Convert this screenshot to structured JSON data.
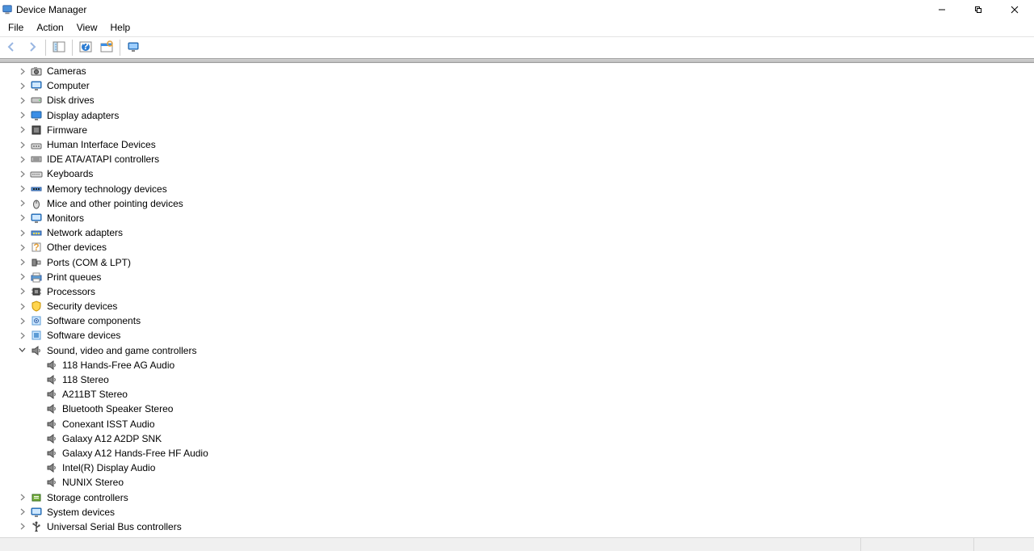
{
  "window": {
    "title": "Device Manager"
  },
  "menu": {
    "items": [
      "File",
      "Action",
      "View",
      "Help"
    ]
  },
  "toolbar": {
    "back": "back-icon",
    "forward": "forward-icon",
    "up_tree": "show-hide-tree-icon",
    "help": "help-icon",
    "scan": "scan-icon",
    "monitor": "monitor-icon"
  },
  "tree": [
    {
      "label": "Cameras",
      "icon": "camera",
      "expanded": false,
      "depth": 1
    },
    {
      "label": "Computer",
      "icon": "computer",
      "expanded": false,
      "depth": 1
    },
    {
      "label": "Disk drives",
      "icon": "disk",
      "expanded": false,
      "depth": 1
    },
    {
      "label": "Display adapters",
      "icon": "display",
      "expanded": false,
      "depth": 1
    },
    {
      "label": "Firmware",
      "icon": "firmware",
      "expanded": false,
      "depth": 1
    },
    {
      "label": "Human Interface Devices",
      "icon": "hid",
      "expanded": false,
      "depth": 1
    },
    {
      "label": "IDE ATA/ATAPI controllers",
      "icon": "ide",
      "expanded": false,
      "depth": 1
    },
    {
      "label": "Keyboards",
      "icon": "keyboard",
      "expanded": false,
      "depth": 1
    },
    {
      "label": "Memory technology devices",
      "icon": "memory",
      "expanded": false,
      "depth": 1
    },
    {
      "label": "Mice and other pointing devices",
      "icon": "mouse",
      "expanded": false,
      "depth": 1
    },
    {
      "label": "Monitors",
      "icon": "monitor",
      "expanded": false,
      "depth": 1
    },
    {
      "label": "Network adapters",
      "icon": "network",
      "expanded": false,
      "depth": 1
    },
    {
      "label": "Other devices",
      "icon": "other",
      "expanded": false,
      "depth": 1
    },
    {
      "label": "Ports (COM & LPT)",
      "icon": "ports",
      "expanded": false,
      "depth": 1
    },
    {
      "label": "Print queues",
      "icon": "printer",
      "expanded": false,
      "depth": 1
    },
    {
      "label": "Processors",
      "icon": "cpu",
      "expanded": false,
      "depth": 1
    },
    {
      "label": "Security devices",
      "icon": "security",
      "expanded": false,
      "depth": 1
    },
    {
      "label": "Software components",
      "icon": "swcomp",
      "expanded": false,
      "depth": 1
    },
    {
      "label": "Software devices",
      "icon": "swdev",
      "expanded": false,
      "depth": 1
    },
    {
      "label": "Sound, video and game controllers",
      "icon": "sound",
      "expanded": true,
      "depth": 1,
      "children": [
        {
          "label": "118 Hands-Free AG Audio",
          "icon": "speaker"
        },
        {
          "label": "118 Stereo",
          "icon": "speaker"
        },
        {
          "label": "A211BT Stereo",
          "icon": "speaker"
        },
        {
          "label": "Bluetooth Speaker Stereo",
          "icon": "speaker"
        },
        {
          "label": "Conexant ISST Audio",
          "icon": "speaker"
        },
        {
          "label": "Galaxy A12 A2DP SNK",
          "icon": "speaker"
        },
        {
          "label": "Galaxy A12 Hands-Free HF Audio",
          "icon": "speaker"
        },
        {
          "label": "Intel(R) Display Audio",
          "icon": "speaker"
        },
        {
          "label": "NUNIX Stereo",
          "icon": "speaker"
        }
      ]
    },
    {
      "label": "Storage controllers",
      "icon": "storage",
      "expanded": false,
      "depth": 1
    },
    {
      "label": "System devices",
      "icon": "system",
      "expanded": false,
      "depth": 1
    },
    {
      "label": "Universal Serial Bus controllers",
      "icon": "usb",
      "expanded": false,
      "depth": 1
    }
  ]
}
